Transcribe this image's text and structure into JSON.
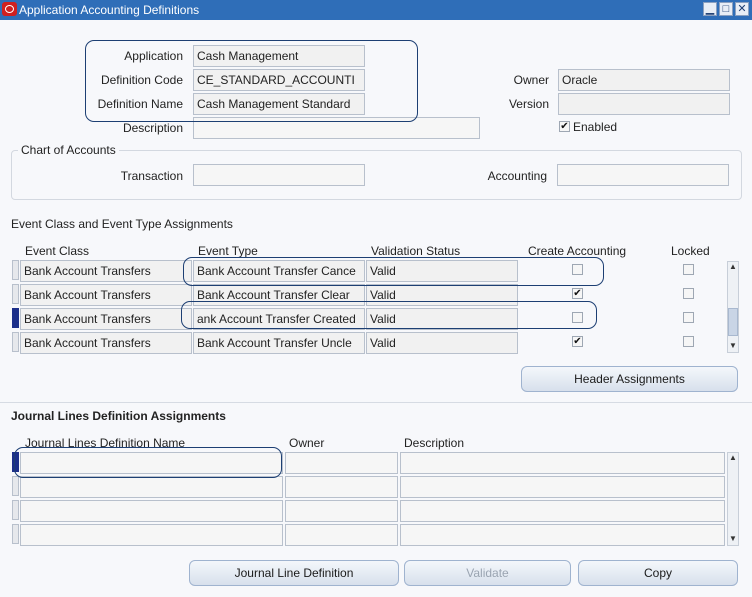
{
  "window": {
    "title": "Application Accounting Definitions"
  },
  "header": {
    "application_label": "Application",
    "application_value": "Cash Management",
    "definition_code_label": "Definition Code",
    "definition_code_value": "CE_STANDARD_ACCOUNTI",
    "definition_name_label": "Definition Name",
    "definition_name_value": "Cash Management Standard",
    "description_label": "Description",
    "description_value": "",
    "owner_label": "Owner",
    "owner_value": "Oracle",
    "version_label": "Version",
    "version_value": "",
    "enabled_label": "Enabled",
    "enabled_checked": true
  },
  "chart_of_accounts": {
    "title": "Chart of Accounts",
    "transaction_label": "Transaction",
    "transaction_value": "",
    "accounting_label": "Accounting",
    "accounting_value": ""
  },
  "event_assignments": {
    "title": "Event Class and Event Type Assignments",
    "columns": [
      "Event Class",
      "Event Type",
      "Validation Status",
      "Create Accounting",
      "Locked"
    ],
    "rows": [
      {
        "event_class": "Bank Account Transfers",
        "event_type": "Bank Account Transfer Cance",
        "status": "Valid",
        "create_accounting": false,
        "locked": false
      },
      {
        "event_class": "Bank Account Transfers",
        "event_type": "Bank Account Transfer Clear",
        "status": "Valid",
        "create_accounting": true,
        "locked": false
      },
      {
        "event_class": "Bank Account Transfers",
        "event_type": "ank Account Transfer Created",
        "status": "Valid",
        "create_accounting": false,
        "locked": false
      },
      {
        "event_class": "Bank Account Transfers",
        "event_type": "Bank Account Transfer Uncle",
        "status": "Valid",
        "create_accounting": true,
        "locked": false
      }
    ],
    "header_assignments_label": "Header Assignments"
  },
  "journal_lines": {
    "title": "Journal Lines Definition Assignments",
    "columns": [
      "Journal Lines Definition Name",
      "Owner",
      "Description"
    ],
    "rows": [
      {
        "name": "",
        "owner": "",
        "description": ""
      },
      {
        "name": "",
        "owner": "",
        "description": ""
      },
      {
        "name": "",
        "owner": "",
        "description": ""
      },
      {
        "name": "",
        "owner": "",
        "description": ""
      }
    ]
  },
  "buttons": {
    "journal_line_definition": "Journal Line Definition",
    "validate": "Validate",
    "copy": "Copy"
  },
  "icons": {
    "app_icon": "oracle-icon",
    "minimize": "minimize-icon",
    "maximize": "maximize-icon",
    "close": "close-icon",
    "checkmark": "✔"
  },
  "colors": {
    "titlebar": "#2f6eb8",
    "highlight": "#1d3f73",
    "active_row": "#1c2f8a"
  }
}
